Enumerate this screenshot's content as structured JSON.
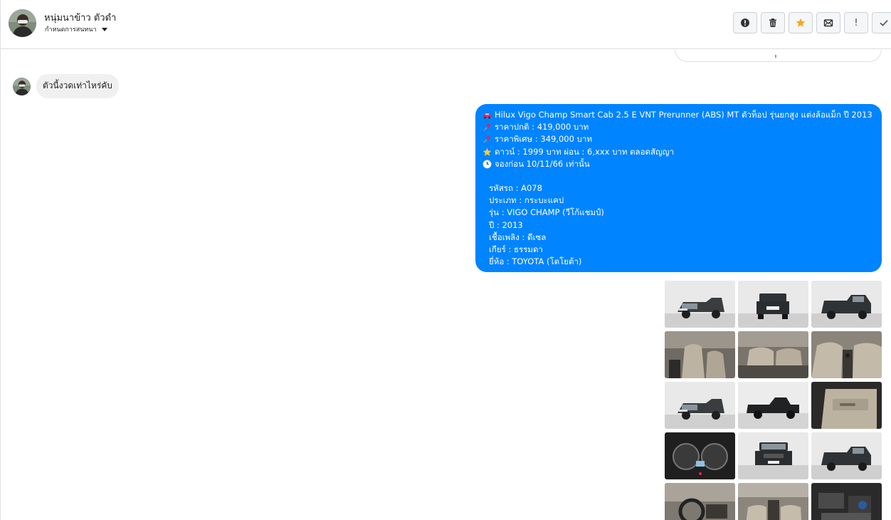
{
  "header": {
    "contact_name": "หนุ่มนาข้าว ตัวดำ",
    "assign_label": "กำหนดการสนทนา",
    "toolbar": [
      {
        "name": "alert-circle-icon",
        "label": ""
      },
      {
        "name": "trash-icon",
        "label": ""
      },
      {
        "name": "star-icon",
        "label": ""
      },
      {
        "name": "mail-icon",
        "label": ""
      },
      {
        "name": "exclamation-icon",
        "label": "!"
      },
      {
        "name": "check-icon",
        "label": ""
      }
    ]
  },
  "colors": {
    "outgoing_bubble": "#0084ff",
    "incoming_bubble": "#f0f0f0",
    "star": "#f5a623"
  },
  "messages": {
    "incoming_text": "ตัวนี้งวดเท่าไหร่คับ",
    "outgoing_lines": [
      {
        "icon": "car-emoji-icon",
        "text": "Hilux Vigo Champ Smart Cab 2.5 E VNT Prerunner (ABS) MT ตัวท็อป รุ่นยกสูง แต่งล้อแม็ก ปี 2013"
      },
      {
        "icon": "pin-emoji-icon",
        "text": "ราคาปกติ : 419,000 บาท"
      },
      {
        "icon": "pin-emoji-icon",
        "text": "ราคาพิเศษ : 349,000 บาท"
      },
      {
        "icon": "star-emoji-icon",
        "text": "ดาวน์ : 1999 บาท ผ่อน : 6,xxx บาท ตลอดสัญญา"
      },
      {
        "icon": "clock-emoji-icon",
        "text": "จองก่อน 10/11/66 เท่านั้น"
      }
    ],
    "outgoing_details": [
      "รหัสรถ : A078",
      "ประเภท : กระบะแคป",
      "รุ่น : VIGO CHAMP (วีโก้แชมป์)",
      "ปี : 2013",
      "เชื้อเพลิง : ดีเซล",
      "เกียร์ : ธรรมดา",
      "ยี่ห้อ : TOYOTA (โตโยต้า)"
    ]
  },
  "gallery": [
    "truck-front-angle",
    "truck-rear",
    "truck-rear-angle",
    "interior-seats",
    "interior-rear-seats",
    "interior-console",
    "truck-front-angle",
    "truck-side",
    "door-panel",
    "gauge-cluster",
    "truck-front",
    "truck-rear-angle",
    "dashboard",
    "interior-dash",
    "engine-bay"
  ]
}
